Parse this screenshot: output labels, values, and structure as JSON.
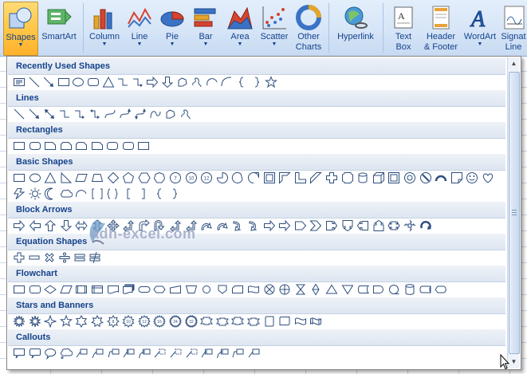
{
  "ribbon": {
    "buttons": [
      {
        "id": "shapes",
        "label": "Shapes",
        "icon": "shapes-icon",
        "dropdown": true,
        "active": true
      },
      {
        "id": "smartart",
        "label": "SmartArt",
        "icon": "smartart-icon"
      },
      {
        "id": "column",
        "label": "Column",
        "icon": "column-chart-icon",
        "dropdown": true
      },
      {
        "id": "line",
        "label": "Line",
        "icon": "line-chart-icon",
        "dropdown": true
      },
      {
        "id": "pie",
        "label": "Pie",
        "icon": "pie-chart-icon",
        "dropdown": true
      },
      {
        "id": "bar",
        "label": "Bar",
        "icon": "bar-chart-icon",
        "dropdown": true
      },
      {
        "id": "area",
        "label": "Area",
        "icon": "area-chart-icon",
        "dropdown": true
      },
      {
        "id": "scatter",
        "label": "Scatter",
        "icon": "scatter-chart-icon",
        "dropdown": true
      },
      {
        "id": "other",
        "label": "Other",
        "label2": "Charts",
        "icon": "other-charts-icon",
        "dropdown": true
      },
      {
        "id": "hyperlink",
        "label": "Hyperlink",
        "icon": "hyperlink-icon"
      },
      {
        "id": "textbox",
        "label": "Text",
        "label2": "Box",
        "icon": "text-box-icon"
      },
      {
        "id": "header",
        "label": "Header",
        "label2": "& Footer",
        "icon": "header-footer-icon"
      },
      {
        "id": "wordart",
        "label": "WordArt",
        "icon": "wordart-icon",
        "dropdown": true
      },
      {
        "id": "signature",
        "label": "Signat",
        "label2": "Line",
        "icon": "signature-line-icon"
      }
    ]
  },
  "gallery": {
    "categories": [
      {
        "name": "Recently Used Shapes"
      },
      {
        "name": "Lines"
      },
      {
        "name": "Rectangles"
      },
      {
        "name": "Basic Shapes"
      },
      {
        "name": "Block Arrows"
      },
      {
        "name": "Equation Shapes"
      },
      {
        "name": "Flowchart"
      },
      {
        "name": "Stars and Banners"
      },
      {
        "name": "Callouts"
      }
    ]
  },
  "watermark": "adh-excel.com",
  "colors": {
    "accent": "#15428b",
    "active": "#ffc94a",
    "ribbon": "#d6e5f7"
  }
}
